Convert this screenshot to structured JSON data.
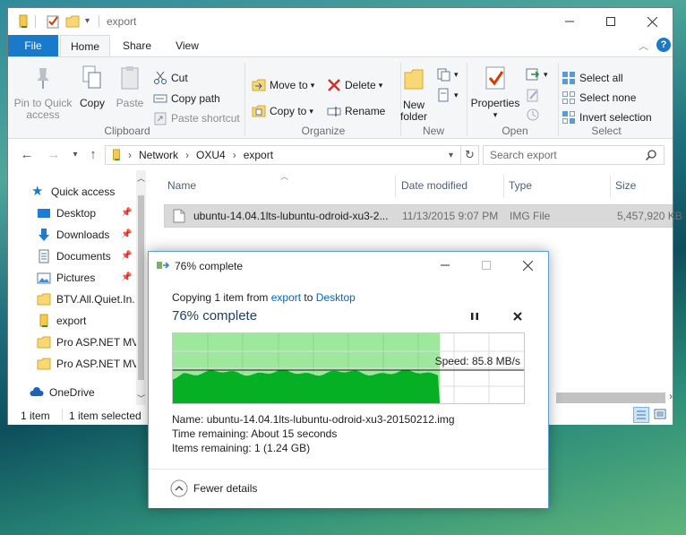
{
  "explorer": {
    "window_title": "export",
    "tabs": {
      "file": "File",
      "home": "Home",
      "share": "Share",
      "view": "View"
    },
    "ribbon": {
      "clipboard": {
        "label": "Clipboard",
        "pin_line1": "Pin to Quick",
        "pin_line2": "access",
        "copy": "Copy",
        "paste": "Paste",
        "cut": "Cut",
        "copy_path": "Copy path",
        "paste_shortcut": "Paste shortcut"
      },
      "organize": {
        "label": "Organize",
        "move_to": "Move to",
        "copy_to": "Copy to",
        "delete": "Delete",
        "rename": "Rename"
      },
      "new": {
        "label": "New",
        "new_folder_line1": "New",
        "new_folder_line2": "folder"
      },
      "open": {
        "label": "Open",
        "properties": "Properties"
      },
      "select": {
        "label": "Select",
        "select_all": "Select all",
        "select_none": "Select none",
        "invert_selection": "Invert selection"
      }
    },
    "address": {
      "segments": [
        "Network",
        "OXU4",
        "export"
      ],
      "search_placeholder": "Search export"
    },
    "nav": {
      "quick_access": "Quick access",
      "items": [
        "Desktop",
        "Downloads",
        "Documents",
        "Pictures",
        "BTV.All.Quiet.In.",
        "export",
        "Pro ASP.NET MV",
        "Pro ASP.NET MV"
      ],
      "onedrive": "OneDrive"
    },
    "columns": {
      "name": "Name",
      "date": "Date modified",
      "type": "Type",
      "size": "Size"
    },
    "file": {
      "name": "ubuntu-14.04.1lts-lubuntu-odroid-xu3-2...",
      "date": "11/13/2015 9:07 PM",
      "type": "IMG File",
      "size": "5,457,920 KB"
    },
    "status": {
      "count": "1 item",
      "selected": "1 item selected"
    }
  },
  "dialog": {
    "title": "76% complete",
    "copy_prefix": "Copying 1 item from",
    "source": "export",
    "to_word": "to",
    "destination": "Desktop",
    "headline": "76% complete",
    "progress": 0.76,
    "speed": "Speed: 85.8 MB/s",
    "name_label": "Name:",
    "name_value": "ubuntu-14.04.1lts-lubuntu-odroid-xu3-20150212.img",
    "time_label": "Time remaining:",
    "time_value": "About 15 seconds",
    "items_label": "Items remaining:",
    "items_value": "1 (1.24 GB)",
    "fewer_details": "Fewer details"
  },
  "colors": {
    "accent": "#1979ca",
    "progress_green": "#06b025",
    "progress_light": "#9ee89e",
    "link": "#0066cc"
  }
}
